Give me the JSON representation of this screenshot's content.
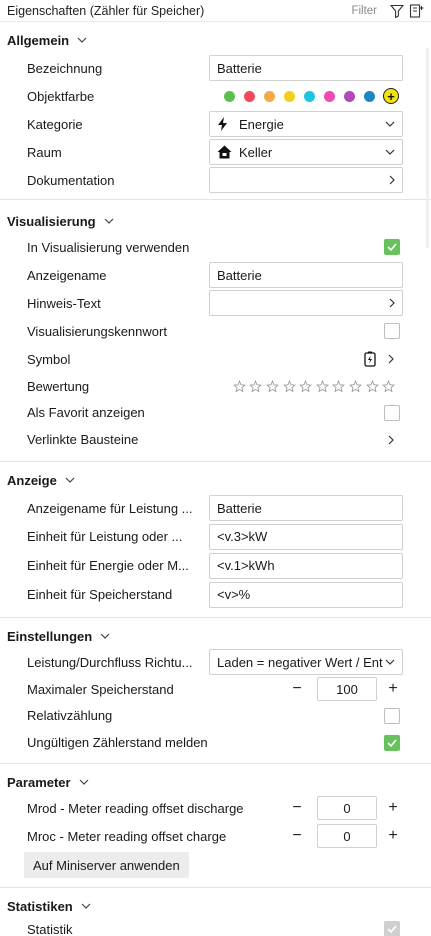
{
  "titlebar": {
    "title": "Eigenschaften (Zähler für Speicher)",
    "filter_label": "Filter",
    "filter_icon": "funnel-icon",
    "layout_icon": "panel-layout-icon"
  },
  "sections": {
    "allgemein": {
      "title": "Allgemein",
      "bezeichnung_label": "Bezeichnung",
      "bezeichnung_value": "Batterie",
      "objektfarbe_label": "Objektfarbe",
      "colors": [
        "#5cbf52",
        "#ef4a5a",
        "#f1a94a",
        "#f2cf1a",
        "#1fc4e0",
        "#ee4ab2",
        "#b04ab8",
        "#1f86c4"
      ],
      "add_color_symbol": "+",
      "kategorie_label": "Kategorie",
      "kategorie_value": "Energie",
      "kategorie_icon": "lightning-icon",
      "raum_label": "Raum",
      "raum_value": "Keller",
      "raum_icon": "house-icon",
      "dokumentation_label": "Dokumentation"
    },
    "visualisierung": {
      "title": "Visualisierung",
      "in_vis_label": "In Visualisierung verwenden",
      "in_vis_checked": true,
      "anzeigename_label": "Anzeigename",
      "anzeigename_value": "Batterie",
      "hinweis_label": "Hinweis-Text",
      "kennwort_label": "Visualisierungskennwort",
      "kennwort_checked": false,
      "symbol_label": "Symbol",
      "symbol_icon": "battery-icon",
      "bewertung_label": "Bewertung",
      "bewertung_stars_filled": 0,
      "bewertung_stars_total": 10,
      "favorit_label": "Als Favorit anzeigen",
      "favorit_checked": false,
      "bausteine_label": "Verlinkte Bausteine"
    },
    "anzeige": {
      "title": "Anzeige",
      "rows": [
        {
          "label": "Anzeigename für Leistung ...",
          "value": "Batterie"
        },
        {
          "label": "Einheit für Leistung oder ...",
          "value": "<v.3>kW"
        },
        {
          "label": "Einheit für Energie oder M...",
          "value": "<v.1>kWh"
        },
        {
          "label": "Einheit für Speicherstand",
          "value": "<v>%"
        }
      ]
    },
    "einstellungen": {
      "title": "Einstellungen",
      "richtung_label": "Leistung/Durchfluss Richtu...",
      "richtung_value": "Laden = negativer Wert / Entladen = positiver Wert",
      "max_label": "Maximaler Speicherstand",
      "max_value": "100",
      "relativ_label": "Relativzählung",
      "relativ_checked": false,
      "ungueltig_label": "Ungültigen Zählerstand melden",
      "ungueltig_checked": true
    },
    "parameter": {
      "title": "Parameter",
      "mrod_label": "Mrod - Meter reading offset discharge",
      "mrod_value": "0",
      "mroc_label": "Mroc - Meter reading offset charge",
      "mroc_value": "0",
      "apply_label": "Auf Miniserver anwenden"
    },
    "statistiken": {
      "title": "Statistiken",
      "statistik_label": "Statistik",
      "statistik_checked": true
    }
  },
  "stepper": {
    "minus": "−",
    "plus": "+"
  }
}
